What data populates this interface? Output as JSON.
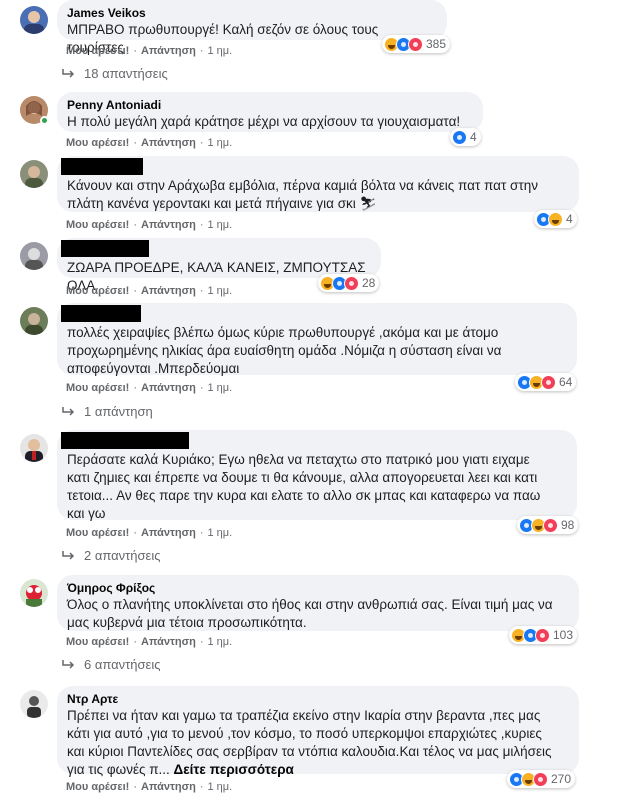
{
  "comments": [
    {
      "name": "James Veikos",
      "text": "ΜΠΡΑΒΟ πρωθυπουργέ! Καλή σεζόν σε όλους τους τουρίστες",
      "like_label": "Μου αρέσει!",
      "reply_label": "Απάντηση",
      "time": "1 ημ.",
      "reaction_count": "385",
      "replies_label": "18 απαντήσεις"
    },
    {
      "name": "Penny Antoniadi",
      "text": "Η πολύ μεγάλη χαρά κράτησε μέχρι να αρχίσουν τα γιουχαισματα!",
      "like_label": "Μου αρέσει!",
      "reply_label": "Απάντηση",
      "time": "1 ημ.",
      "reaction_count": "4"
    },
    {
      "name": "",
      "text": "Κάνουν και στην Αράχωβα εμβόλια, πέρνα καμιά βόλτα να κάνεις πατ πατ στην\nπλάτη κανένα γεροντακι και μετά πήγαινε για σκι ⛷",
      "like_label": "Μου αρέσει!",
      "reply_label": "Απάντηση",
      "time": "1 ημ.",
      "reaction_count": "4"
    },
    {
      "name": "",
      "text": "ΖΩΑΡΑ ΠΡΟΕΔΡΕ, ΚΑΛΆ ΚΑΝΕΙΣ, ΖΜΠΟΥΤΣΑΣ ΟΛΑ",
      "like_label": "Μου αρέσει!",
      "reply_label": "Απάντηση",
      "time": "1 ημ.",
      "reaction_count": "28"
    },
    {
      "name": "",
      "text": "πολλές χειραψίες βλέπω όμως κύριε πρωθυπουργέ ,ακόμα και με άτομο\nπροχωρημένης ηλικίας άρα ευαίσθητη ομάδα .Νόμιζα η σύσταση είναι να\nαποφεύγονται .Μπερδεύομαι",
      "like_label": "Μου αρέσει!",
      "reply_label": "Απάντηση",
      "time": "1 ημ.",
      "reaction_count": "64",
      "replies_label": "1 απάντηση"
    },
    {
      "name": "",
      "text": "Περάσατε καλά Κυριάκο; Εγω ηθελα να πεταχτω στο πατρικό μου γιατι ειχαμε\nκατι ζημιες και έπρεπε να δουμε τι θα κάνουμε, αλλα απογορευεται λεει και κατι\nτετοια... Αν θες παρε την κυρα και ελατε το αλλο σκ μπας και καταφερω να παω\nκαι γω",
      "like_label": "Μου αρέσει!",
      "reply_label": "Απάντηση",
      "time": "1 ημ.",
      "reaction_count": "98",
      "replies_label": "2 απαντήσεις"
    },
    {
      "name": "Όμηρος Φρίξος",
      "text": "Όλος ο πλανήτης υποκλίνεται στο ήθος και στην ανθρωπιά σας. Είναι τιμή μας να\nμας κυβερνά μια τέτοια προσωπικότητα.",
      "like_label": "Μου αρέσει!",
      "reply_label": "Απάντηση",
      "time": "1 ημ.",
      "reaction_count": "103",
      "replies_label": "6 απαντήσεις"
    },
    {
      "name": "Ντρ Αρτε",
      "text": "Πρέπει να ήταν και γαμω τα τραπέζια εκείνο στην Ικαρία στην βεραντα ,πες μας\nκάτι για αυτό ,για το μενού ,τον κόσμο, το ποσό υπερκομψοι επαρχιώτες ,κυριες\nκαι κύριοι Παντελίδες σας σερβίραν τα ντόπια καλουδια.Και τέλος να μας μιλήσεις\nγια τις φωνές π... ",
      "more_label": "Δείτε περισσότερα",
      "like_label": "Μου αρέσει!",
      "reply_label": "Απάντηση",
      "time": "1 ημ.",
      "reaction_count": "270"
    }
  ]
}
